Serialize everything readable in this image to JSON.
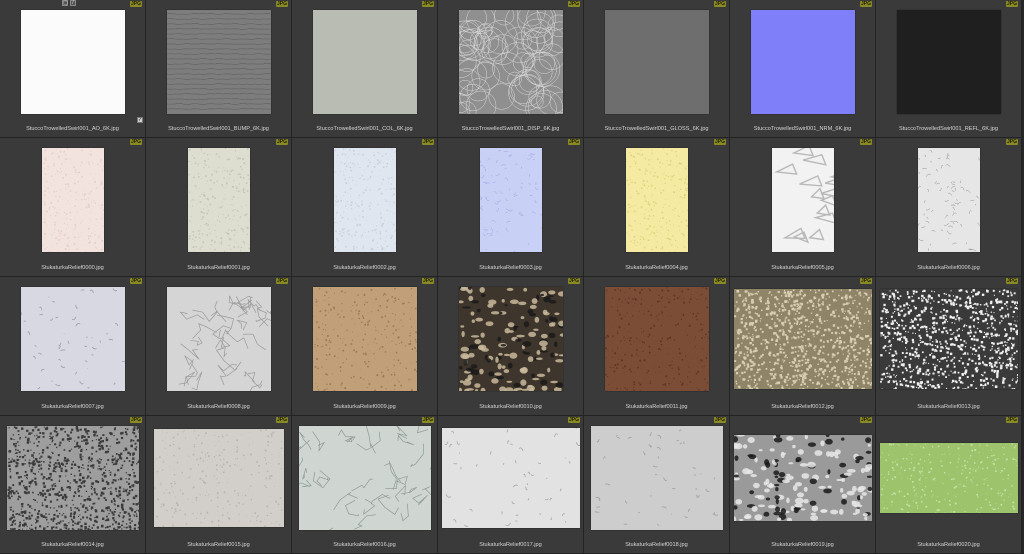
{
  "badge_label": "JPG",
  "items": [
    {
      "name": "StuccoTrowelledSwirl001_AO_6K.jpg",
      "shape": "sq",
      "style": "ao"
    },
    {
      "name": "StuccoTrowelledSwirl001_BUMP_6K.jpg",
      "shape": "sq",
      "style": "bump"
    },
    {
      "name": "StuccoTrowelledSwirl001_COL_6K.jpg",
      "shape": "sq",
      "style": "col"
    },
    {
      "name": "StuccoTrowelledSwirl001_DISP_6K.jpg",
      "shape": "sq",
      "style": "disp"
    },
    {
      "name": "StuccoTrowelledSwirl001_GLOSS_6K.jpg",
      "shape": "sq",
      "style": "gloss"
    },
    {
      "name": "StuccoTrowelledSwirl001_NRM_6K.jpg",
      "shape": "sq",
      "style": "nrm"
    },
    {
      "name": "StuccoTrowelledSwirl001_REFL_6K.jpg",
      "shape": "sq",
      "style": "refl"
    },
    {
      "name": "StukaturkaRelief0000.jpg",
      "shape": "portrait",
      "style": "r0"
    },
    {
      "name": "StukaturkaRelief0001.jpg",
      "shape": "portrait",
      "style": "r1"
    },
    {
      "name": "StukaturkaRelief0002.jpg",
      "shape": "portrait",
      "style": "r2"
    },
    {
      "name": "StukaturkaRelief0003.jpg",
      "shape": "portrait",
      "style": "r3"
    },
    {
      "name": "StukaturkaRelief0004.jpg",
      "shape": "portrait",
      "style": "r4"
    },
    {
      "name": "StukaturkaRelief0005.jpg",
      "shape": "portrait",
      "style": "r5"
    },
    {
      "name": "StukaturkaRelief0006.jpg",
      "shape": "portrait",
      "style": "r6"
    },
    {
      "name": "StukaturkaRelief0007.jpg",
      "shape": "sq",
      "style": "r7"
    },
    {
      "name": "StukaturkaRelief0008.jpg",
      "shape": "sq",
      "style": "r8"
    },
    {
      "name": "StukaturkaRelief0009.jpg",
      "shape": "sq",
      "style": "r9"
    },
    {
      "name": "StukaturkaRelief0010.jpg",
      "shape": "sq",
      "style": "r10"
    },
    {
      "name": "StukaturkaRelief0011.jpg",
      "shape": "sq",
      "style": "r11"
    },
    {
      "name": "StukaturkaRelief0012.jpg",
      "shape": "wide2",
      "style": "r12"
    },
    {
      "name": "StukaturkaRelief0013.jpg",
      "shape": "wide2",
      "style": "r13"
    },
    {
      "name": "StukaturkaRelief0014.jpg",
      "shape": "wide",
      "style": "r14"
    },
    {
      "name": "StukaturkaRelief0015.jpg",
      "shape": "wide3",
      "style": "r15"
    },
    {
      "name": "StukaturkaRelief0016.jpg",
      "shape": "wide",
      "style": "r16"
    },
    {
      "name": "StukaturkaRelief0017.jpg",
      "shape": "wide2",
      "style": "r17"
    },
    {
      "name": "StukaturkaRelief0018.jpg",
      "shape": "wide",
      "style": "r18"
    },
    {
      "name": "StukaturkaRelief0019.jpg",
      "shape": "wide4",
      "style": "r19"
    },
    {
      "name": "StukaturkaRelief0020.jpg",
      "shape": "wide5",
      "style": "r20"
    }
  ],
  "styles": {
    "ao": {
      "base": "#fbfbfb",
      "pattern": "none",
      "ink": "#ececec"
    },
    "bump": {
      "base": "#7d7d7d",
      "pattern": "waves",
      "ink": "#5f5f5f"
    },
    "col": {
      "base": "#b9bcb3",
      "pattern": "none",
      "ink": "#b2b5ac"
    },
    "disp": {
      "base": "#8f8f8f",
      "pattern": "arcs",
      "ink": "#d9d9d9"
    },
    "gloss": {
      "base": "#6e6e6e",
      "pattern": "none",
      "ink": "#6a6a6a"
    },
    "nrm": {
      "base": "#7f7ff9",
      "pattern": "none",
      "ink": "#8585ff"
    },
    "refl": {
      "base": "#1f1f1f",
      "pattern": "none",
      "ink": "#232323"
    },
    "r0": {
      "base": "#f3e3de",
      "pattern": "speck",
      "ink": "#e3cfca"
    },
    "r1": {
      "base": "#deded0",
      "pattern": "speck",
      "ink": "#c4c4b4"
    },
    "r2": {
      "base": "#dfe6f0",
      "pattern": "speck",
      "ink": "#c7d0dc"
    },
    "r3": {
      "base": "#c9d0f5",
      "pattern": "streaks",
      "ink": "#98a2de"
    },
    "r4": {
      "base": "#f4eaa2",
      "pattern": "speck",
      "ink": "#e0d480"
    },
    "r5": {
      "base": "#f2f2f2",
      "pattern": "blobs",
      "ink": "#b8b8b8"
    },
    "r6": {
      "base": "#e6e6e6",
      "pattern": "streaks",
      "ink": "#8f8f8f"
    },
    "r7": {
      "base": "#d8d8e2",
      "pattern": "strokes",
      "ink": "#9c9cab"
    },
    "r8": {
      "base": "#d5d5d5",
      "pattern": "cracks",
      "ink": "#9a9a9a"
    },
    "r9": {
      "base": "#c19f78",
      "pattern": "speck",
      "ink": "#9a7a55"
    },
    "r10": {
      "base": "#3e362c",
      "pattern": "holes",
      "ink": "#c9b99b"
    },
    "r11": {
      "base": "#7b4c36",
      "pattern": "speck",
      "ink": "#5a3525"
    },
    "r12": {
      "base": "#8f8468",
      "pattern": "noise",
      "ink": "#d7cdb0"
    },
    "r13": {
      "base": "#3a3a3a",
      "pattern": "noise",
      "ink": "#f0f0f0"
    },
    "r14": {
      "base": "#9e9e9e",
      "pattern": "noise",
      "ink": "#3b3b3b"
    },
    "r15": {
      "base": "#d2cfca",
      "pattern": "speck",
      "ink": "#b8b4ad"
    },
    "r16": {
      "base": "#cfd6d2",
      "pattern": "cracks",
      "ink": "#8e9995"
    },
    "r17": {
      "base": "#e2e2e2",
      "pattern": "strokes",
      "ink": "#a8a8a8"
    },
    "r18": {
      "base": "#cdcdcd",
      "pattern": "strokes",
      "ink": "#a0a0a0"
    },
    "r19": {
      "base": "#9a9a9a",
      "pattern": "holes",
      "ink": "#e8e8e8"
    },
    "r20": {
      "base": "#9dc46c",
      "pattern": "speck",
      "ink": "#c8e2a8"
    }
  }
}
